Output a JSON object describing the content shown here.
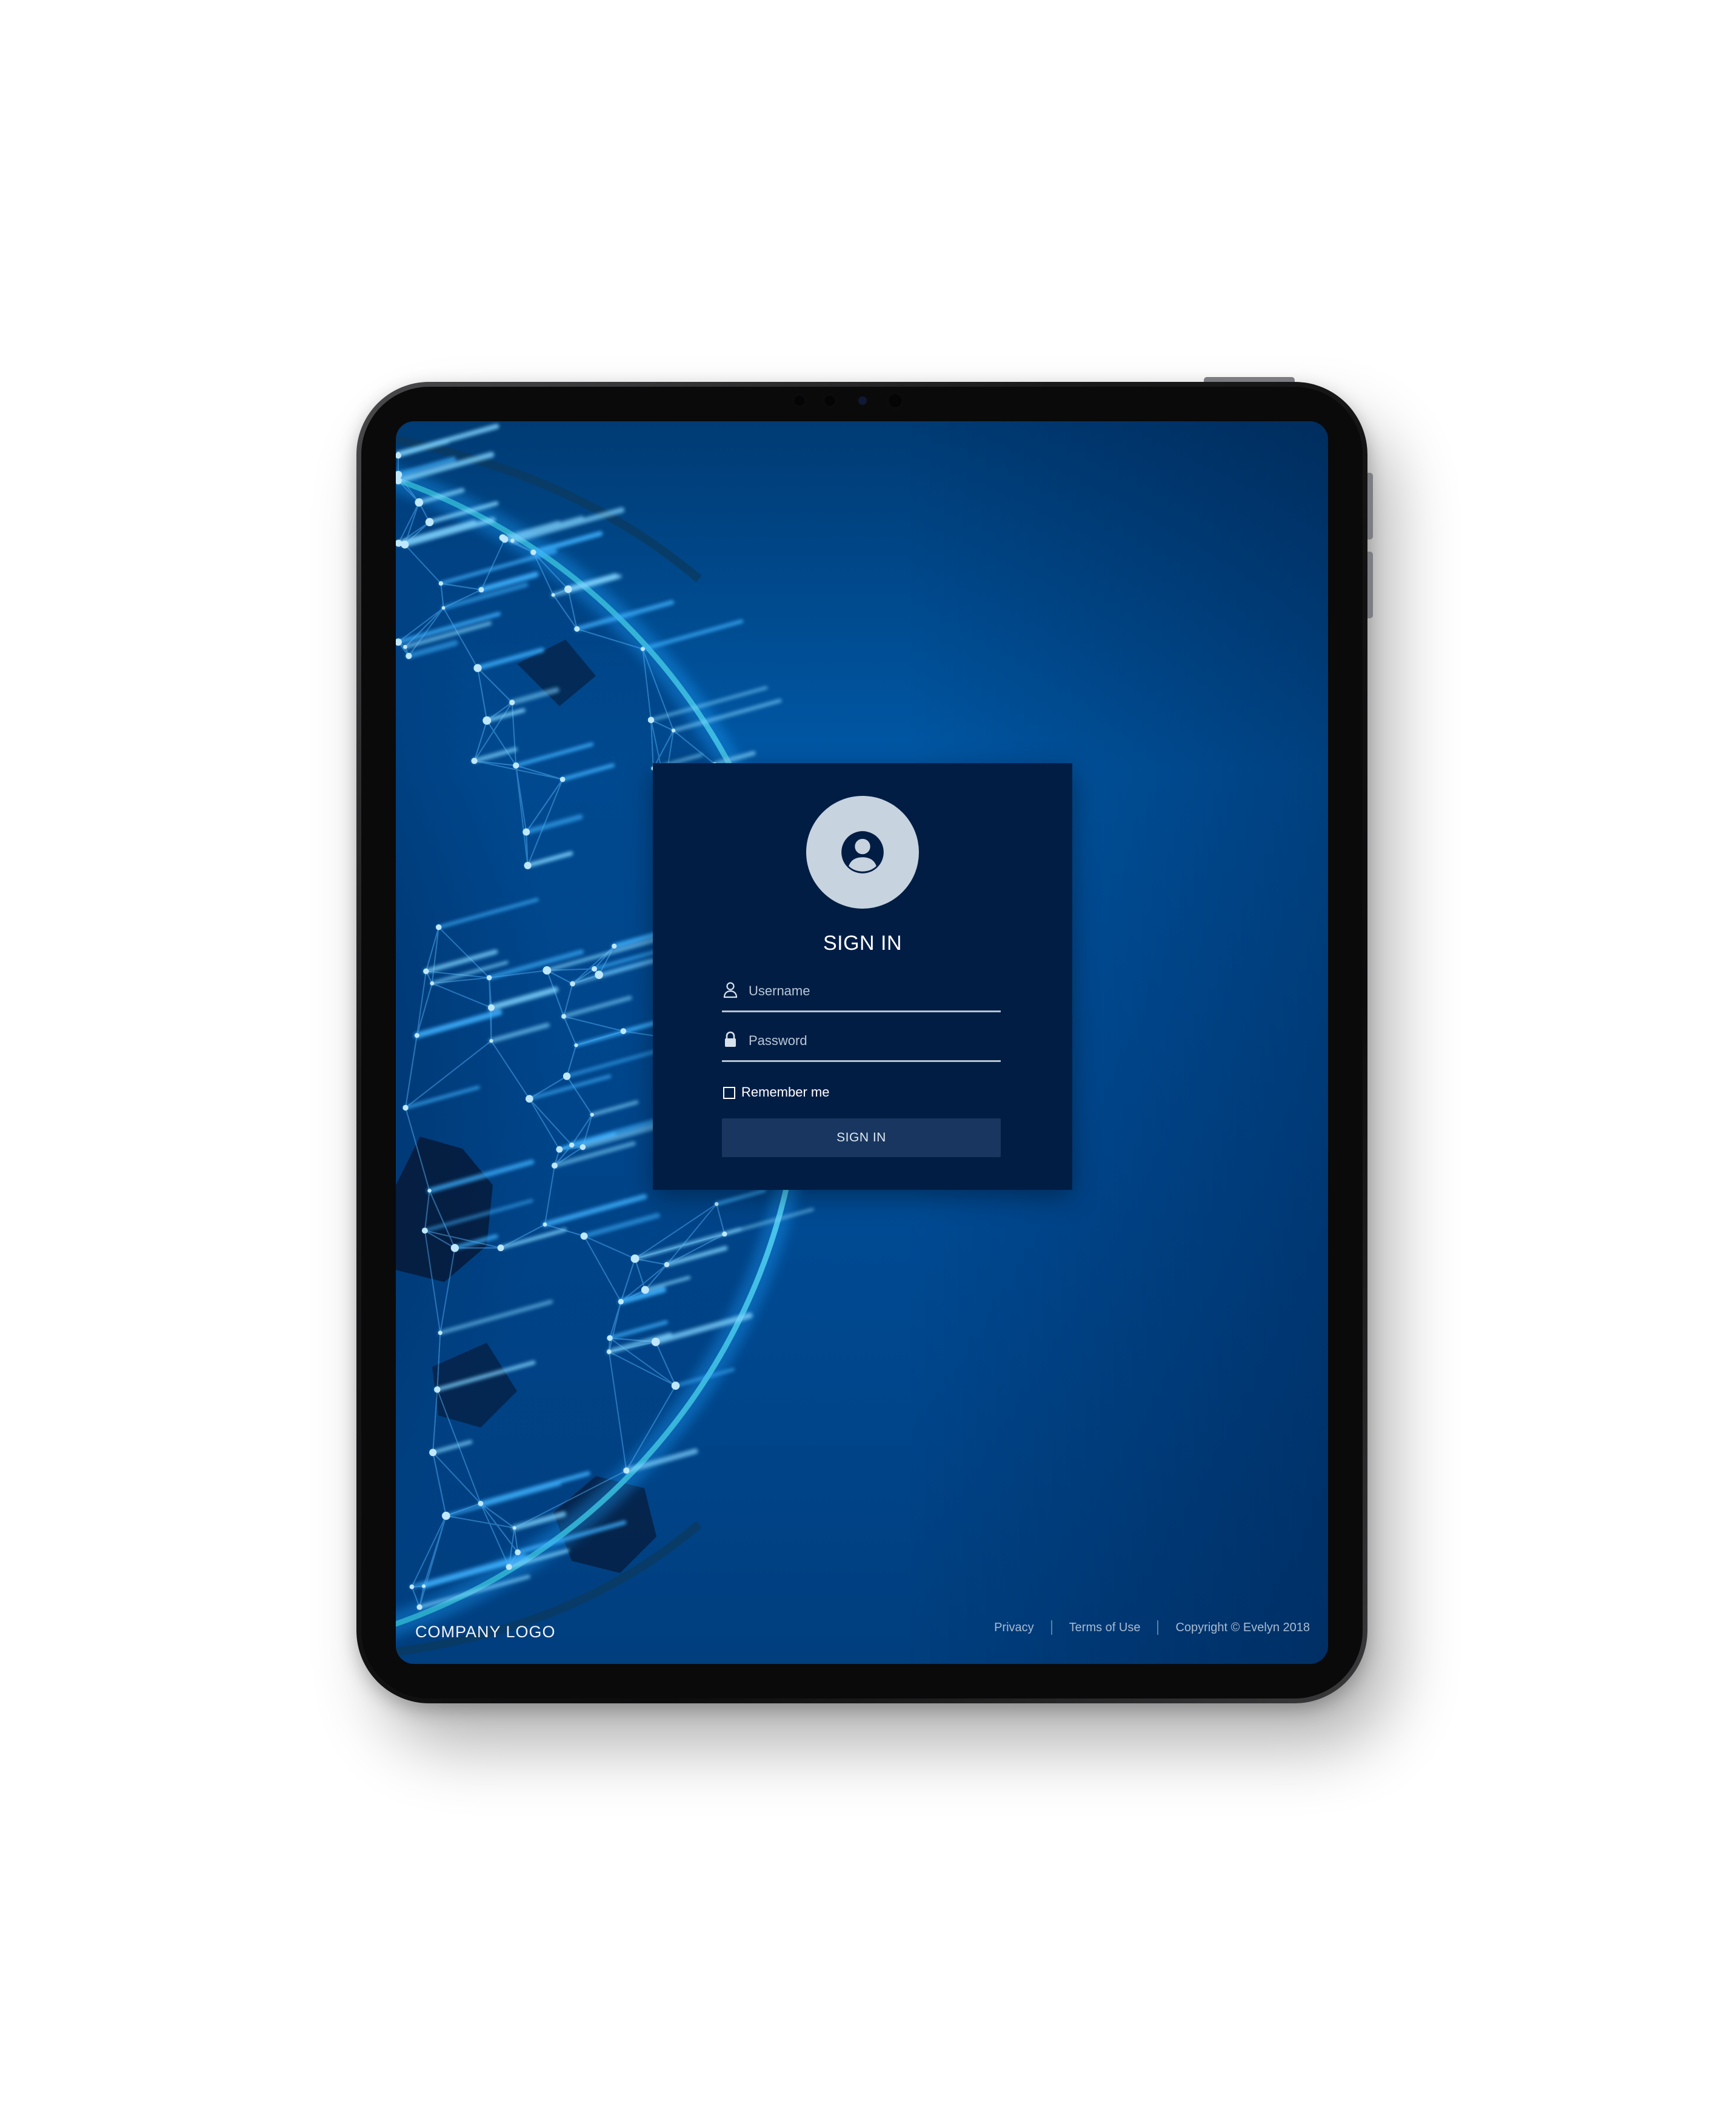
{
  "login": {
    "title": "SIGN IN",
    "username_placeholder": "Username",
    "password_placeholder": "Password",
    "remember_label": "Remember me",
    "submit_label": "SIGN IN",
    "icons": {
      "avatar": "user-circle-icon",
      "username": "user-icon",
      "password": "lock-icon"
    }
  },
  "footer": {
    "logo_text": "COMPANY LOGO",
    "privacy": "Privacy",
    "terms": "Terms of Use",
    "copyright": "Copyright © Evelyn 2018"
  },
  "colors": {
    "card_background": "#021d44",
    "button_background": "#18365f",
    "screen_background": "#0058a6",
    "accent_glow": "#3fb2ff"
  }
}
